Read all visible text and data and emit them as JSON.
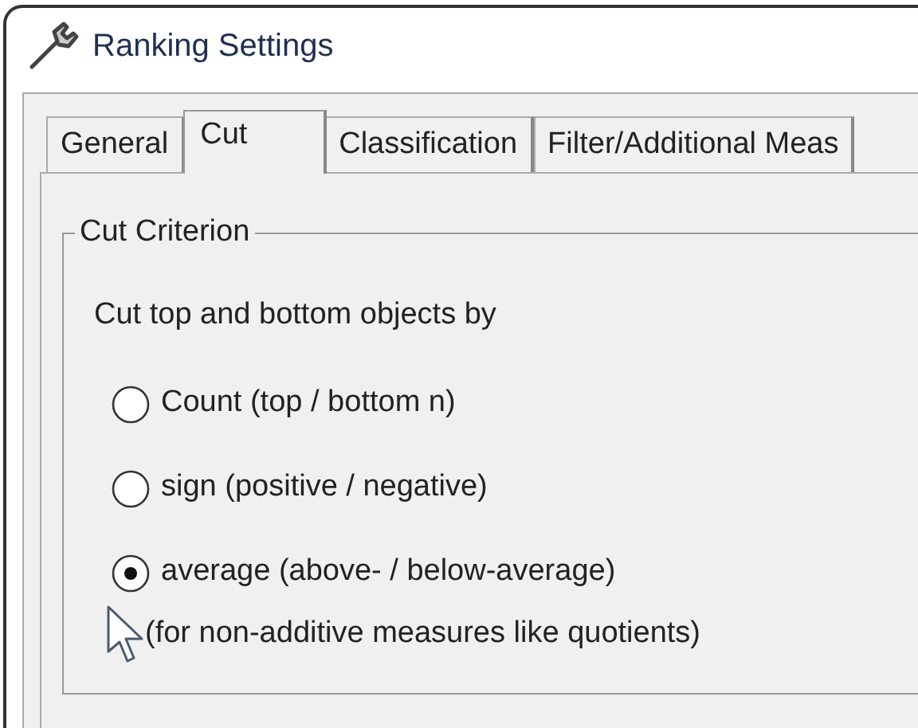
{
  "window": {
    "title": "Ranking Settings"
  },
  "tabs": [
    {
      "label": "General",
      "selected": false
    },
    {
      "label": "Cut",
      "selected": true
    },
    {
      "label": "Classification",
      "selected": false
    },
    {
      "label": "Filter/Additional Meas",
      "selected": false
    }
  ],
  "group": {
    "title": "Cut Criterion",
    "prompt": "Cut top and bottom objects by",
    "options": [
      {
        "label": "Count (top / bottom n)",
        "selected": false
      },
      {
        "label": "sign (positive / negative)",
        "selected": false
      },
      {
        "label": "average (above- / below-average)",
        "selected": true,
        "hint": "(for non-additive measures like quotients)"
      }
    ]
  }
}
